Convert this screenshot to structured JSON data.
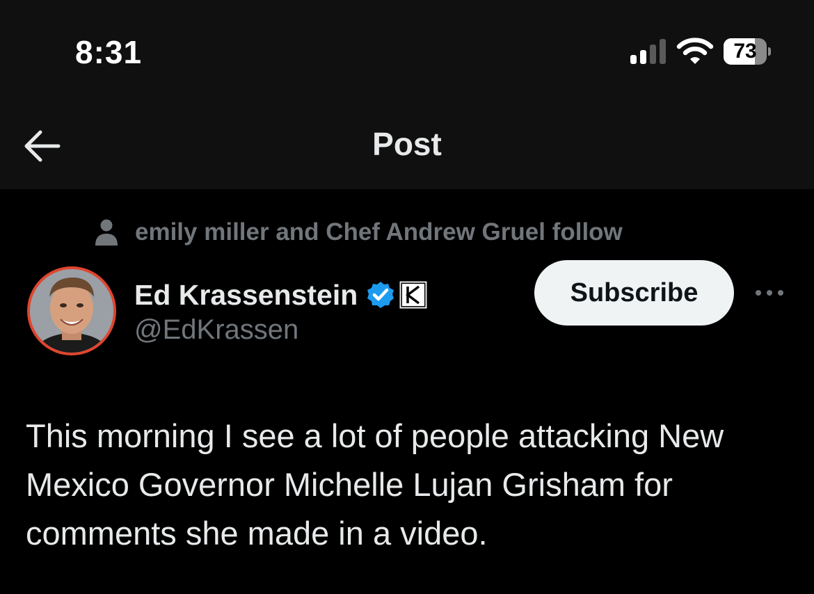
{
  "status_bar": {
    "time": "8:31",
    "signal_bars_active": 2,
    "signal_bars_total": 4,
    "wifi_icon": "wifi-icon",
    "battery_level_text": "73",
    "battery_fraction": 0.73
  },
  "header": {
    "back_icon": "arrow-left-icon",
    "title": "Post"
  },
  "social_context": {
    "icon": "person-icon",
    "text": "emily miller and Chef Andrew Gruel follow"
  },
  "author": {
    "name": "Ed Krassenstein",
    "handle": "@EdKrassen",
    "verified_icon": "verified-badge-icon",
    "affiliation_icon": "k-affiliation-badge-icon",
    "avatar_ring_color": "#e0452e"
  },
  "actions": {
    "subscribe_label": "Subscribe",
    "more_icon": "more-horizontal-icon"
  },
  "post": {
    "text": "This morning I see a lot of people attacking New Mexico Governor Michelle Lujan Grisham for comments she made in a video."
  },
  "colors": {
    "background": "#000000",
    "bar_background": "#101010",
    "primary_text": "#e7e9ea",
    "secondary_text": "#71767b",
    "verified_blue": "#1d9bf0",
    "button_background": "#eff3f4",
    "button_text": "#0f1419"
  }
}
